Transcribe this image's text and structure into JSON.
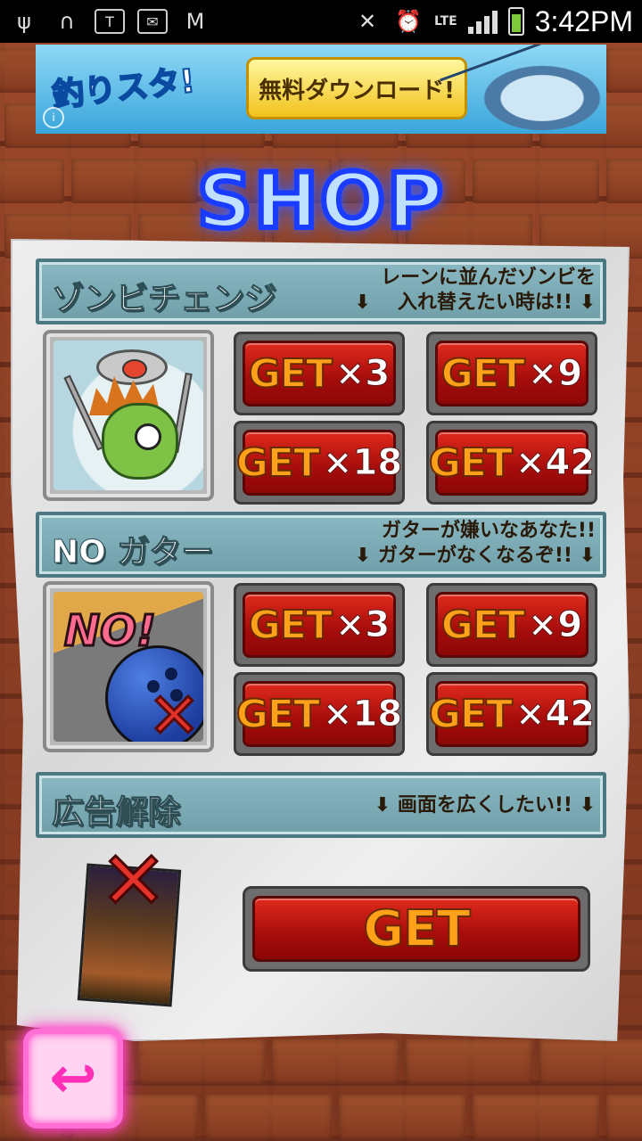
{
  "status_bar": {
    "time": "3:42PM",
    "network": "LTE",
    "icons": [
      "usb-icon",
      "headphones-icon",
      "vpn-shield-icon",
      "mail-icon",
      "gmail-icon",
      "mute-icon",
      "alarm-icon",
      "signal-icon",
      "battery-charging-icon"
    ]
  },
  "ad_banner": {
    "logo": "釣りスタ!",
    "button_label": "無料ダウンロード!"
  },
  "shop": {
    "title": "SHOP"
  },
  "sections": [
    {
      "title": "ゾンビチェンジ",
      "desc_line1": "レーンに並んだゾンビを",
      "desc_line2": "入れ替えたい時は!!",
      "icon": "zombie-claw-icon",
      "buttons": [
        {
          "word": "GET",
          "mult": "×3"
        },
        {
          "word": "GET",
          "mult": "×9"
        },
        {
          "word": "GET",
          "mult": "×18"
        },
        {
          "word": "GET",
          "mult": "×42"
        }
      ]
    },
    {
      "title": "NO ガター",
      "desc_line1": "ガターが嫌いなあなた!!",
      "desc_line2": "ガターがなくなるぞ!!",
      "icon": "no-gutter-icon",
      "icon_text": "NO!",
      "buttons": [
        {
          "word": "GET",
          "mult": "×3"
        },
        {
          "word": "GET",
          "mult": "×9"
        },
        {
          "word": "GET",
          "mult": "×18"
        },
        {
          "word": "GET",
          "mult": "×42"
        }
      ]
    },
    {
      "title": "広告解除",
      "desc_line1": "画面を広くしたい!!",
      "icon": "ad-removal-icon",
      "button": {
        "word": "GET"
      }
    }
  ],
  "colors": {
    "button_red": "#c2160f",
    "button_text_orange": "#ffa21a",
    "neon_blue": "#1a3cff",
    "neon_pink": "#ff3ec8",
    "section_teal": "#7aaab4"
  }
}
